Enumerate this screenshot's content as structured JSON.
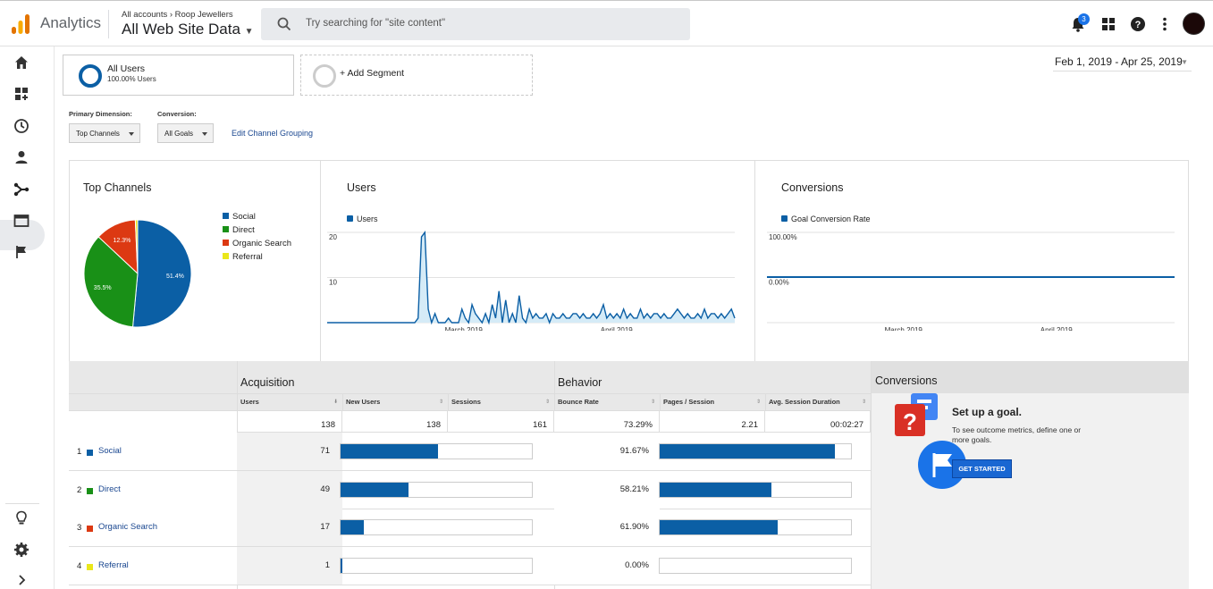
{
  "header": {
    "app_title": "Analytics",
    "breadcrumb": "All accounts › Roop Jewellers",
    "view_name": "All Web Site Data",
    "search_placeholder": "Try searching for \"site content\"",
    "notification_count": "3"
  },
  "segments": {
    "all_users_label": "All Users",
    "all_users_sub": "100.00% Users",
    "add_segment_label": "+ Add Segment"
  },
  "date_range": "Feb 1, 2019 - Apr 25, 2019",
  "controls": {
    "primary_dimension_label": "Primary Dimension:",
    "primary_dimension_value": "Top Channels",
    "conversion_label": "Conversion:",
    "conversion_value": "All Goals",
    "edit_link": "Edit Channel Grouping"
  },
  "colors": {
    "social": "#0b5fa5",
    "direct": "#199017",
    "organic": "#dc3912",
    "referral": "#eae71b",
    "accent": "#1967d2"
  },
  "chart_data": [
    {
      "type": "pie",
      "title": "Top Channels",
      "categories": [
        "Social",
        "Direct",
        "Organic Search",
        "Referral"
      ],
      "values": [
        51.4,
        35.5,
        12.3,
        0.7
      ],
      "data_labels": [
        "51.4%",
        "35.5%",
        "12.3%",
        ""
      ]
    },
    {
      "type": "area",
      "title": "Users",
      "series": [
        {
          "name": "Users",
          "values": [
            0,
            0,
            0,
            0,
            0,
            0,
            0,
            0,
            0,
            0,
            0,
            0,
            0,
            0,
            0,
            0,
            0,
            0,
            0,
            0,
            0,
            0,
            0,
            0,
            0,
            0,
            0,
            1,
            19,
            20,
            3,
            0,
            2,
            0,
            0,
            0,
            1,
            0,
            0,
            0,
            3,
            1,
            0,
            4,
            2,
            1,
            0,
            2,
            0,
            4,
            1,
            7,
            0,
            5,
            0,
            2,
            0,
            6,
            1,
            0,
            3,
            1,
            2,
            1,
            1,
            2,
            0,
            2,
            1,
            1,
            2,
            1,
            1,
            2,
            2,
            1,
            2,
            1,
            1,
            2,
            1,
            2,
            4,
            1,
            2,
            1,
            2,
            1,
            3,
            1,
            2,
            1,
            1,
            3,
            1,
            2,
            1,
            2,
            2,
            1,
            2,
            1,
            1,
            2,
            3,
            2,
            1,
            2,
            1,
            1,
            2,
            1,
            3,
            1,
            2,
            2,
            1,
            2,
            1,
            2,
            3,
            1
          ]
        }
      ],
      "x_labels": [
        "March 2019",
        "April 2019"
      ],
      "y_ticks": [
        "20",
        "10"
      ],
      "ylim": [
        0,
        20
      ]
    },
    {
      "type": "line",
      "title": "Conversions",
      "series": [
        {
          "name": "Goal Conversion Rate",
          "values": [
            0.0
          ]
        }
      ],
      "x_labels": [
        "March 2019",
        "April 2019"
      ],
      "y_ticks": [
        "100.00%",
        "0.00%"
      ]
    }
  ],
  "table": {
    "acquisition_title": "Acquisition",
    "behavior_title": "Behavior",
    "conversions_title": "Conversions",
    "columns": [
      "Users",
      "New Users",
      "Sessions",
      "Bounce Rate",
      "Pages / Session",
      "Avg. Session Duration"
    ],
    "totals": [
      "138",
      "138",
      "161",
      "73.29%",
      "2.21",
      "00:02:27"
    ],
    "rows": [
      {
        "index": "1",
        "label": "Social",
        "users": "71",
        "users_frac": 0.51,
        "bounce": "91.67%",
        "bounce_frac": 0.9167
      },
      {
        "index": "2",
        "label": "Direct",
        "users": "49",
        "users_frac": 0.355,
        "bounce": "58.21%",
        "bounce_frac": 0.5821
      },
      {
        "index": "3",
        "label": "Organic Search",
        "users": "17",
        "users_frac": 0.123,
        "bounce": "61.90%",
        "bounce_frac": 0.619
      },
      {
        "index": "4",
        "label": "Referral",
        "users": "1",
        "users_frac": 0.007,
        "bounce": "0.00%",
        "bounce_frac": 0.0
      }
    ]
  },
  "goal_panel": {
    "title": "Set up a goal.",
    "description": "To see outcome metrics, define one or more goals.",
    "button": "GET STARTED"
  }
}
